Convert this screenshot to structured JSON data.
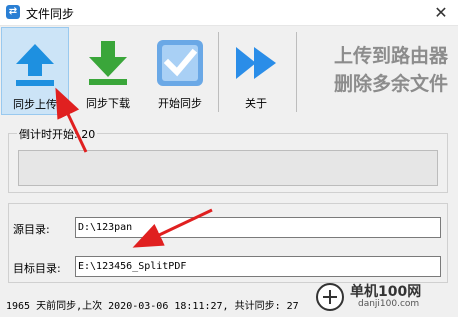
{
  "window": {
    "title": "文件同步",
    "close_glyph": "✕"
  },
  "toolbar": {
    "buttons": [
      {
        "label": "同步上传",
        "icon": "upload-arrow-icon",
        "active": true
      },
      {
        "label": "同步下载",
        "icon": "download-arrow-icon",
        "active": false
      },
      {
        "label": "开始同步",
        "icon": "checkmark-icon",
        "active": false
      },
      {
        "label": "关于",
        "icon": "fast-forward-icon",
        "active": false
      }
    ],
    "promo_line1": "上传到路由器",
    "promo_line2": "删除多余文件"
  },
  "countdown": {
    "legend": "倒计时开始: 20",
    "progress_percent": 0
  },
  "paths": {
    "source_label": "源目录:",
    "source_value": "D:\\123pan",
    "target_label": "目标目录:",
    "target_value": "E:\\123456_SplitPDF"
  },
  "status": {
    "text": "1965 天前同步,上次 2020-03-06 18:11:27, 共计同步: 27"
  },
  "watermark": {
    "site": "单机100网",
    "domain": "danji100.com"
  },
  "colors": {
    "accent_blue": "#1e90e0",
    "download_green": "#3aa63a",
    "check_blue": "#5b9fe0",
    "annotation_red": "#e02020",
    "active_button_bg": "#cce4f7"
  }
}
